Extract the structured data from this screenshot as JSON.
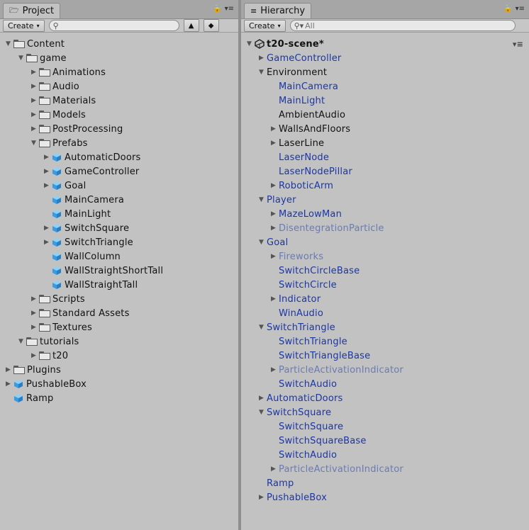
{
  "project": {
    "tab_label": "Project",
    "create_label": "Create",
    "search_placeholder": "",
    "tree": [
      {
        "label": "Content",
        "depth": 0,
        "icon": "folder",
        "arrow": "down",
        "style": "dark"
      },
      {
        "label": "game",
        "depth": 1,
        "icon": "folder",
        "arrow": "down",
        "style": "dark"
      },
      {
        "label": "Animations",
        "depth": 2,
        "icon": "folder",
        "arrow": "right",
        "style": "dark"
      },
      {
        "label": "Audio",
        "depth": 2,
        "icon": "folder",
        "arrow": "right",
        "style": "dark"
      },
      {
        "label": "Materials",
        "depth": 2,
        "icon": "folder",
        "arrow": "right",
        "style": "dark"
      },
      {
        "label": "Models",
        "depth": 2,
        "icon": "folder",
        "arrow": "right",
        "style": "dark"
      },
      {
        "label": "PostProcessing",
        "depth": 2,
        "icon": "folder",
        "arrow": "right",
        "style": "dark"
      },
      {
        "label": "Prefabs",
        "depth": 2,
        "icon": "folder",
        "arrow": "down",
        "style": "dark"
      },
      {
        "label": "AutomaticDoors",
        "depth": 3,
        "icon": "prefab",
        "arrow": "right",
        "style": "dark"
      },
      {
        "label": "GameController",
        "depth": 3,
        "icon": "prefab",
        "arrow": "right",
        "style": "dark"
      },
      {
        "label": "Goal",
        "depth": 3,
        "icon": "prefab",
        "arrow": "right",
        "style": "dark"
      },
      {
        "label": "MainCamera",
        "depth": 3,
        "icon": "prefab",
        "arrow": "none",
        "style": "dark"
      },
      {
        "label": "MainLight",
        "depth": 3,
        "icon": "prefab",
        "arrow": "none",
        "style": "dark"
      },
      {
        "label": "SwitchSquare",
        "depth": 3,
        "icon": "prefab",
        "arrow": "right",
        "style": "dark"
      },
      {
        "label": "SwitchTriangle",
        "depth": 3,
        "icon": "prefab",
        "arrow": "right",
        "style": "dark"
      },
      {
        "label": "WallColumn",
        "depth": 3,
        "icon": "prefab",
        "arrow": "none",
        "style": "dark"
      },
      {
        "label": "WallStraightShortTall",
        "depth": 3,
        "icon": "prefab",
        "arrow": "none",
        "style": "dark"
      },
      {
        "label": "WallStraightTall",
        "depth": 3,
        "icon": "prefab",
        "arrow": "none",
        "style": "dark"
      },
      {
        "label": "Scripts",
        "depth": 2,
        "icon": "folder",
        "arrow": "right",
        "style": "dark"
      },
      {
        "label": "Standard Assets",
        "depth": 2,
        "icon": "folder",
        "arrow": "right",
        "style": "dark"
      },
      {
        "label": "Textures",
        "depth": 2,
        "icon": "folder",
        "arrow": "right",
        "style": "dark"
      },
      {
        "label": "tutorials",
        "depth": 1,
        "icon": "folder",
        "arrow": "down",
        "style": "dark"
      },
      {
        "label": "t20",
        "depth": 2,
        "icon": "folder",
        "arrow": "right",
        "style": "dark"
      },
      {
        "label": "Plugins",
        "depth": 0,
        "icon": "folder",
        "arrow": "right",
        "style": "dark"
      },
      {
        "label": "PushableBox",
        "depth": 0,
        "icon": "prefab",
        "arrow": "right",
        "style": "dark"
      },
      {
        "label": "Ramp",
        "depth": 0,
        "icon": "prefab",
        "arrow": "none",
        "style": "dark"
      }
    ]
  },
  "hierarchy": {
    "tab_label": "Hierarchy",
    "create_label": "Create",
    "search_placeholder": "All",
    "scene_name": "t20-scene*",
    "tree": [
      {
        "label": "GameController",
        "depth": 1,
        "arrow": "right",
        "style": "blue"
      },
      {
        "label": "Environment",
        "depth": 1,
        "arrow": "down",
        "style": "dark"
      },
      {
        "label": "MainCamera",
        "depth": 2,
        "arrow": "none",
        "style": "blue"
      },
      {
        "label": "MainLight",
        "depth": 2,
        "arrow": "none",
        "style": "blue"
      },
      {
        "label": "AmbientAudio",
        "depth": 2,
        "arrow": "none",
        "style": "dark"
      },
      {
        "label": "WallsAndFloors",
        "depth": 2,
        "arrow": "right",
        "style": "dark"
      },
      {
        "label": "LaserLine",
        "depth": 2,
        "arrow": "right",
        "style": "dark"
      },
      {
        "label": "LaserNode",
        "depth": 2,
        "arrow": "none",
        "style": "blue"
      },
      {
        "label": "LaserNodePillar",
        "depth": 2,
        "arrow": "none",
        "style": "blue"
      },
      {
        "label": "RoboticArm",
        "depth": 2,
        "arrow": "right",
        "style": "blue"
      },
      {
        "label": "Player",
        "depth": 1,
        "arrow": "down",
        "style": "blue"
      },
      {
        "label": "MazeLowMan",
        "depth": 2,
        "arrow": "right",
        "style": "blue"
      },
      {
        "label": "DisentegrationParticle",
        "depth": 2,
        "arrow": "right",
        "style": "faded"
      },
      {
        "label": "Goal",
        "depth": 1,
        "arrow": "down",
        "style": "blue"
      },
      {
        "label": "Fireworks",
        "depth": 2,
        "arrow": "right",
        "style": "faded"
      },
      {
        "label": "SwitchCircleBase",
        "depth": 2,
        "arrow": "none",
        "style": "blue"
      },
      {
        "label": "SwitchCircle",
        "depth": 2,
        "arrow": "none",
        "style": "blue"
      },
      {
        "label": "Indicator",
        "depth": 2,
        "arrow": "right",
        "style": "blue"
      },
      {
        "label": "WinAudio",
        "depth": 2,
        "arrow": "none",
        "style": "blue"
      },
      {
        "label": "SwitchTriangle",
        "depth": 1,
        "arrow": "down",
        "style": "blue"
      },
      {
        "label": "SwitchTriangle",
        "depth": 2,
        "arrow": "none",
        "style": "blue"
      },
      {
        "label": "SwitchTriangleBase",
        "depth": 2,
        "arrow": "none",
        "style": "blue"
      },
      {
        "label": "ParticleActivationIndicator",
        "depth": 2,
        "arrow": "right",
        "style": "faded"
      },
      {
        "label": "SwitchAudio",
        "depth": 2,
        "arrow": "none",
        "style": "blue"
      },
      {
        "label": "AutomaticDoors",
        "depth": 1,
        "arrow": "right",
        "style": "blue"
      },
      {
        "label": "SwitchSquare",
        "depth": 1,
        "arrow": "down",
        "style": "blue"
      },
      {
        "label": "SwitchSquare",
        "depth": 2,
        "arrow": "none",
        "style": "blue"
      },
      {
        "label": "SwitchSquareBase",
        "depth": 2,
        "arrow": "none",
        "style": "blue"
      },
      {
        "label": "SwitchAudio",
        "depth": 2,
        "arrow": "none",
        "style": "blue"
      },
      {
        "label": "ParticleActivationIndicator",
        "depth": 2,
        "arrow": "right",
        "style": "faded"
      },
      {
        "label": "Ramp",
        "depth": 1,
        "arrow": "none",
        "style": "blue"
      },
      {
        "label": "PushableBox",
        "depth": 1,
        "arrow": "right",
        "style": "blue"
      }
    ]
  }
}
